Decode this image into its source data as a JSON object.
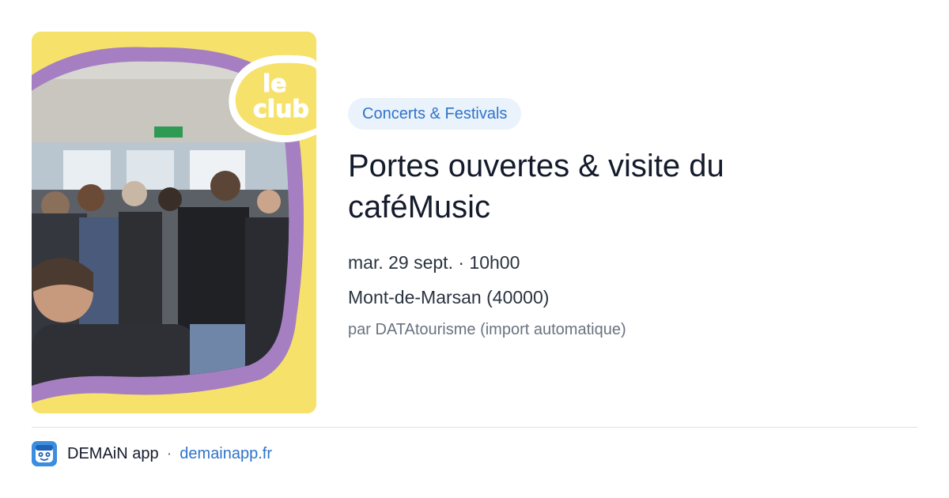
{
  "event": {
    "category": "Concerts & Festivals",
    "title": "Portes ouvertes & visite du caféMusic",
    "datetime": "mar. 29 sept. · 10h00",
    "location": "Mont-de-Marsan (40000)",
    "source": "par DATAtourisme (import automatique)",
    "image": {
      "description_icon": "event-photo",
      "badge_text": "Le Clu"
    }
  },
  "footer": {
    "app_name": "DEMAiN app",
    "separator": "·",
    "url": "demainapp.fr",
    "icon": "demain-app-icon"
  },
  "colors": {
    "accent": "#2f74c8",
    "pill_background": "#eaf2fb",
    "image_yellow": "#f7e36a",
    "image_purple": "#a47fc1"
  }
}
